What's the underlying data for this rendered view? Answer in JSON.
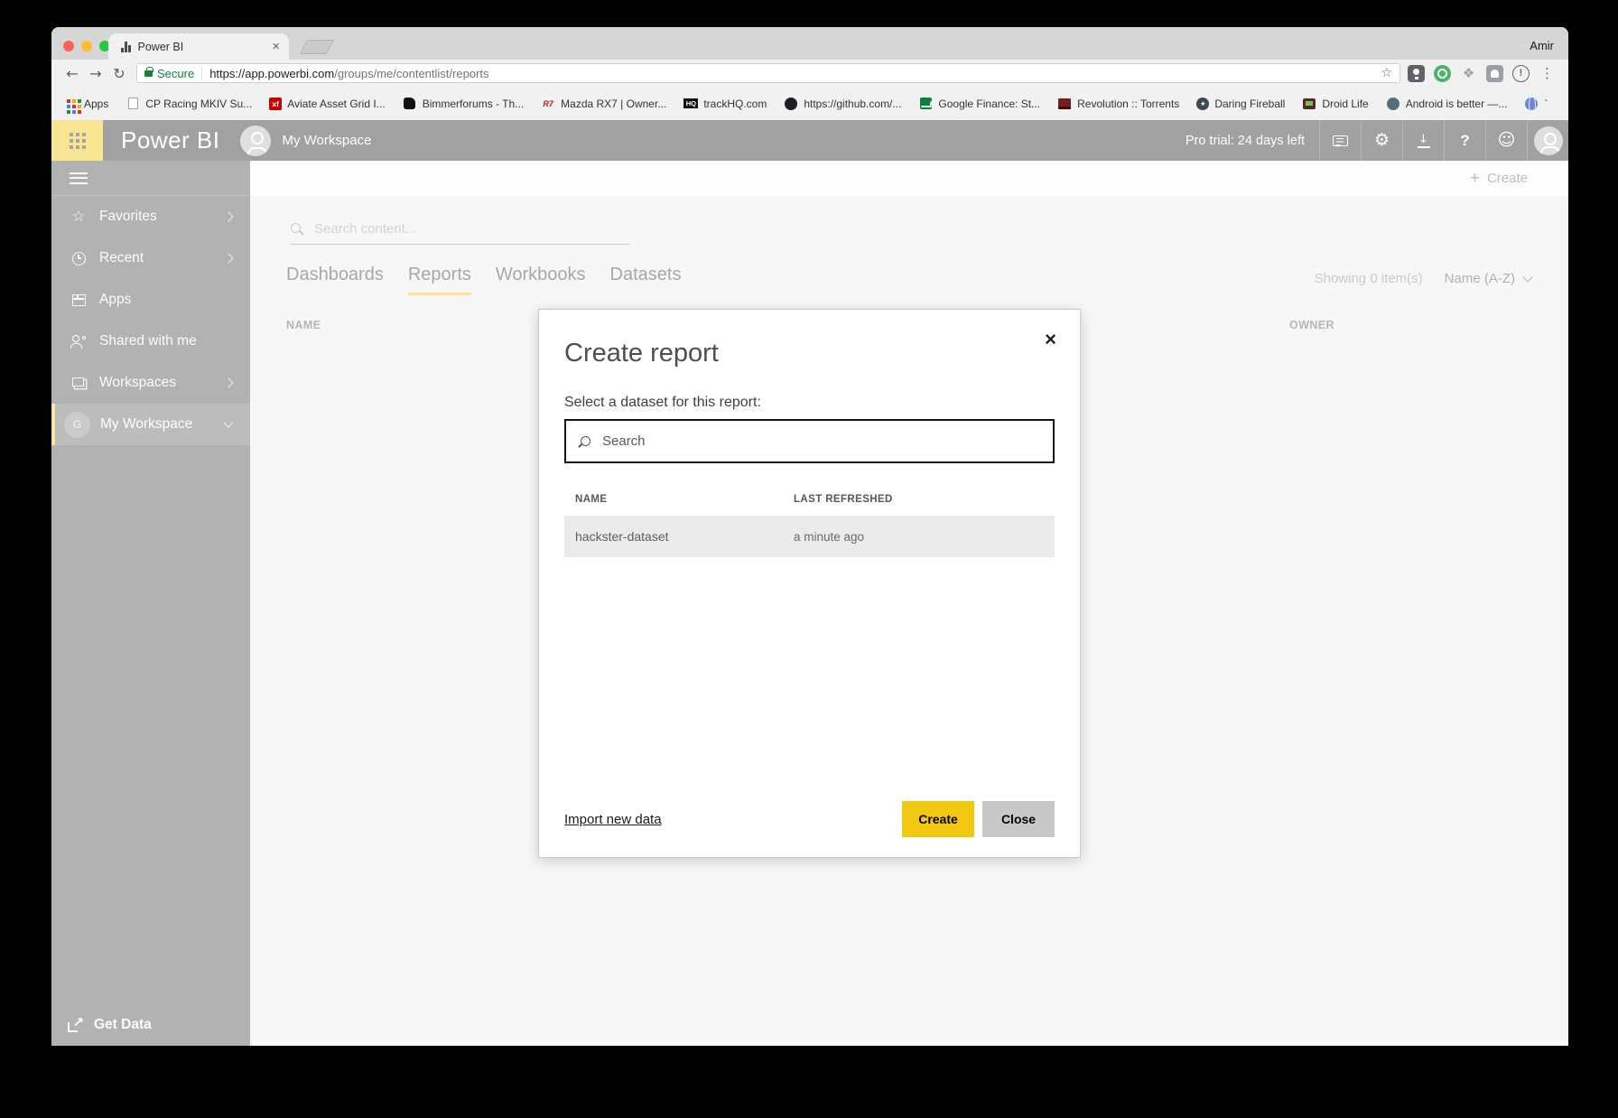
{
  "browser": {
    "tab": {
      "title": "Power BI",
      "close_glyph": "×"
    },
    "profile": "Amir",
    "nav": {
      "back": "←",
      "forward": "→",
      "reload": "↻"
    },
    "omnibox": {
      "secure_label": "Secure",
      "url_host": "https://app.powerbi.com",
      "url_path": "/groups/me/contentlist/reports",
      "star_glyph": "☆"
    },
    "menu_glyph": "⋮",
    "info_glyph": "!",
    "dropbox_glyph": "❖",
    "bookmarks": [
      {
        "label": "Apps"
      },
      {
        "label": "CP Racing MKIV Su..."
      },
      {
        "label": "Aviate Asset Grid I...",
        "glyph": "xf"
      },
      {
        "label": "Bimmerforums - Th..."
      },
      {
        "label": "Mazda RX7 | Owner...",
        "glyph": "R7"
      },
      {
        "label": "trackHQ.com",
        "glyph": "HQ"
      },
      {
        "label": "https://github.com/..."
      },
      {
        "label": "Google Finance: St..."
      },
      {
        "label": "Revolution :: Torrents"
      },
      {
        "label": "Daring Fireball",
        "glyph": "★"
      },
      {
        "label": "Droid Life"
      },
      {
        "label": "Android is better —..."
      },
      {
        "label": "`"
      }
    ]
  },
  "pbi_header": {
    "brand": "Power BI",
    "workspace": "My Workspace",
    "pro_trial": "Pro trial: 24 days left",
    "gear_glyph": "⚙",
    "down_glyph": "↓",
    "help_glyph": "?",
    "smile_glyph": "☺"
  },
  "sidebar": {
    "items": [
      {
        "label": "Favorites"
      },
      {
        "label": "Recent"
      },
      {
        "label": "Apps"
      },
      {
        "label": "Shared with me"
      },
      {
        "label": "Workspaces"
      }
    ],
    "selected": {
      "label": "My Workspace",
      "avatar_letter": "G"
    },
    "get_data": "Get Data",
    "get_data_arrow": "↗"
  },
  "content": {
    "create_plus": "+",
    "create_label": "Create",
    "search_placeholder": "Search content...",
    "tabs": [
      {
        "label": "Dashboards"
      },
      {
        "label": "Reports"
      },
      {
        "label": "Workbooks"
      },
      {
        "label": "Datasets"
      }
    ],
    "showing": "Showing 0 item(s)",
    "sort": "Name (A-Z)",
    "columns": {
      "name": "NAME",
      "owner": "OWNER"
    }
  },
  "modal": {
    "title": "Create report",
    "close_glyph": "×",
    "select_label": "Select a dataset for this report:",
    "search_placeholder": "Search",
    "columns": {
      "name": "NAME",
      "last_refreshed": "LAST REFRESHED"
    },
    "rows": [
      {
        "name": "hackster-dataset",
        "last_refreshed": "a minute ago"
      }
    ],
    "import_link": "Import new data",
    "create_button": "Create",
    "close_button": "Close"
  },
  "colors": {
    "accent_yellow": "#F2C811",
    "secure_green": "#188038",
    "close_button_gray": "#C8C8C8"
  }
}
